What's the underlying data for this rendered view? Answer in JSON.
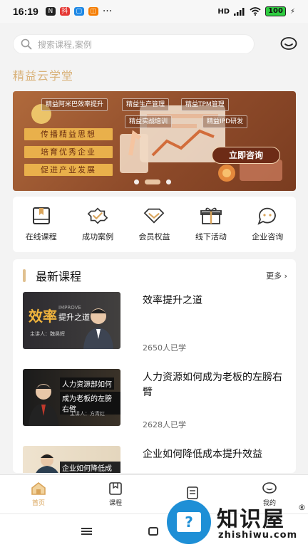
{
  "status_bar": {
    "time": "16:19",
    "signal": "HD",
    "battery": "100"
  },
  "search": {
    "placeholder": "搜索课程,案例"
  },
  "brand": {
    "name": "精益云学堂"
  },
  "banner": {
    "tags": [
      "精益阿米巴效率提升",
      "精益生产管理",
      "精益TPM管理",
      "精益实战培训",
      "精益IPD研发"
    ],
    "slogans": [
      "传播精益思想",
      "培育优秀企业",
      "促进产业发展"
    ],
    "cta": "立即咨询",
    "slide_count": 3,
    "active_slide": 2
  },
  "quick_menu": [
    {
      "label": "在线课程",
      "icon": "online-course-icon"
    },
    {
      "label": "成功案例",
      "icon": "success-case-icon"
    },
    {
      "label": "会员权益",
      "icon": "member-benefit-icon"
    },
    {
      "label": "线下活动",
      "icon": "offline-activity-icon"
    },
    {
      "label": "企业咨询",
      "icon": "consulting-icon"
    }
  ],
  "courses": {
    "title": "最新课程",
    "more": "更多",
    "items": [
      {
        "title": "效率提升之道",
        "learners": "2650人已学",
        "thumb_text": "效率",
        "thumb_sub": "提升之道",
        "thumb_tag": "IMPROVE",
        "thumb_speaker": "主讲人：魏昊辉"
      },
      {
        "title": "人力资源如何成为老板的左膀右臂",
        "learners": "2628人已学",
        "thumb_text": "人力资源部如何",
        "thumb_sub": "成为老板的左膀右臂",
        "thumb_speaker": "主讲人：方青红"
      },
      {
        "title": "企业如何降低成本提升效益",
        "learners": "",
        "thumb_text": "企业如何降低成本"
      }
    ]
  },
  "tabbar": [
    {
      "label": "首页",
      "icon": "home-icon",
      "active": true
    },
    {
      "label": "课程",
      "icon": "course-icon",
      "active": false
    },
    {
      "label": "",
      "icon": "document-icon",
      "active": false
    },
    {
      "label": "我的",
      "icon": "profile-icon",
      "active": false
    }
  ],
  "watermark": {
    "text": "知识屋",
    "registered": "®",
    "url": "zhishiwu.com"
  },
  "colors": {
    "accent": "#d9a45a",
    "brand_text": "#d9b27a",
    "banner_bg": "#8e4b2a",
    "cta_bg": "#6d2b16",
    "watermark_blue": "#1e8fd6"
  }
}
